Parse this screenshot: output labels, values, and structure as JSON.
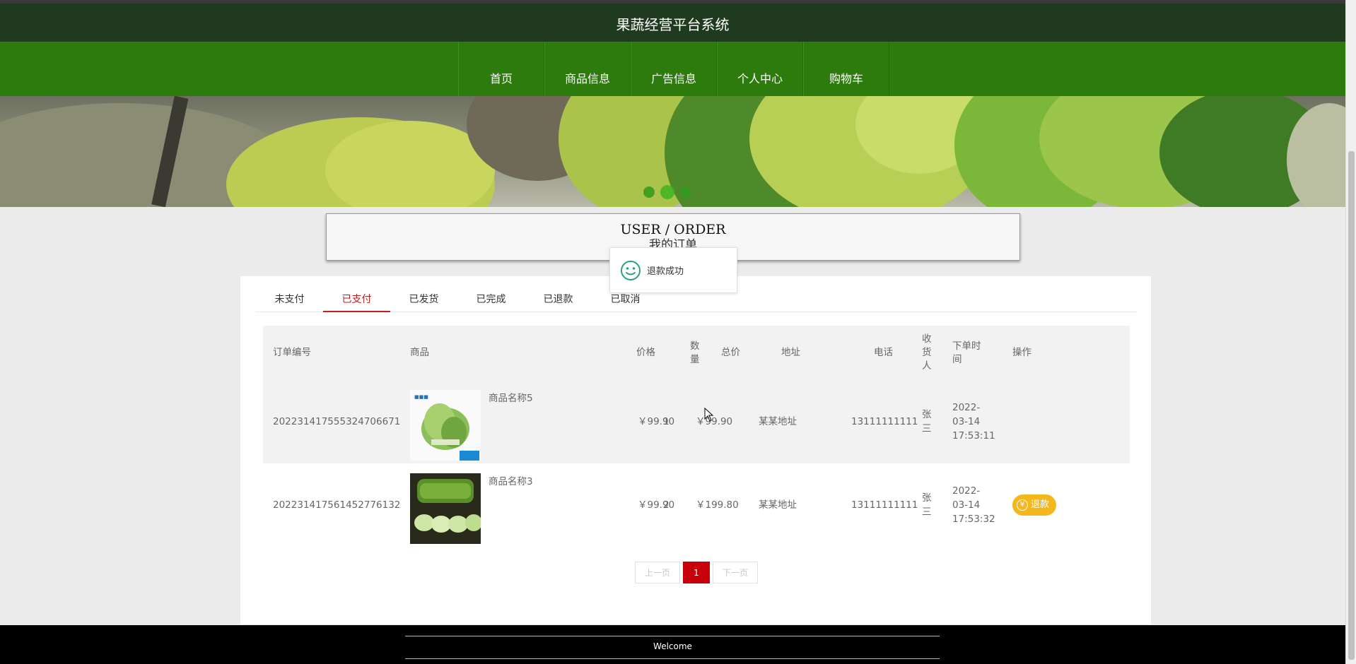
{
  "header": {
    "title": "果蔬经营平台系统"
  },
  "nav": [
    {
      "label": "首页"
    },
    {
      "label": "商品信息"
    },
    {
      "label": "广告信息"
    },
    {
      "label": "个人中心"
    },
    {
      "label": "购物车"
    }
  ],
  "banner": {
    "slides": 3,
    "active_slide": 2
  },
  "section": {
    "title_en": "USER / ORDER",
    "title_cn": "我的订单"
  },
  "toast": {
    "text": "退款成功",
    "icon": "smile-icon"
  },
  "tabs": [
    {
      "label": "未支付",
      "active": false
    },
    {
      "label": "已支付",
      "active": true
    },
    {
      "label": "已发货",
      "active": false
    },
    {
      "label": "已完成",
      "active": false
    },
    {
      "label": "已退款",
      "active": false
    },
    {
      "label": "已取消",
      "active": false
    }
  ],
  "table": {
    "headers": {
      "order_no": "订单编号",
      "goods": "商品",
      "price": "价格",
      "qty_l1": "数",
      "qty_l2": "量",
      "total": "总价",
      "address": "地址",
      "phone": "电话",
      "recv_l1": "收",
      "recv_l2": "货",
      "recv_l3": "人",
      "time_l1": "下单时",
      "time_l2": "间",
      "action": "操作"
    },
    "rows": [
      {
        "order_no": "202231417555324706671",
        "goods": "商品名称5",
        "price": "￥99.90",
        "qty": "1",
        "total": "￥99.90",
        "address": "某某地址",
        "phone": "13111111111",
        "recv_l1": "张",
        "recv_l2": "三",
        "date": "2022-",
        "date2": "03-14",
        "time": "17:53:11",
        "action": ""
      },
      {
        "order_no": "202231417561452776132",
        "goods": "商品名称3",
        "price": "￥99.90",
        "qty": "2",
        "total": "￥199.80",
        "address": "某某地址",
        "phone": "13111111111",
        "recv_l1": "张",
        "recv_l2": "三",
        "date": "2022-",
        "date2": "03-14",
        "time": "17:53:32",
        "action": "退款"
      }
    ]
  },
  "pager": {
    "prev": "上一页",
    "current": "1",
    "next": "下一页"
  },
  "footer": {
    "text": "Welcome"
  },
  "colors": {
    "header": "#1f3a1f",
    "nav": "#2d7a0d",
    "accent": "#c21f1f",
    "refund": "#f5b81c"
  }
}
